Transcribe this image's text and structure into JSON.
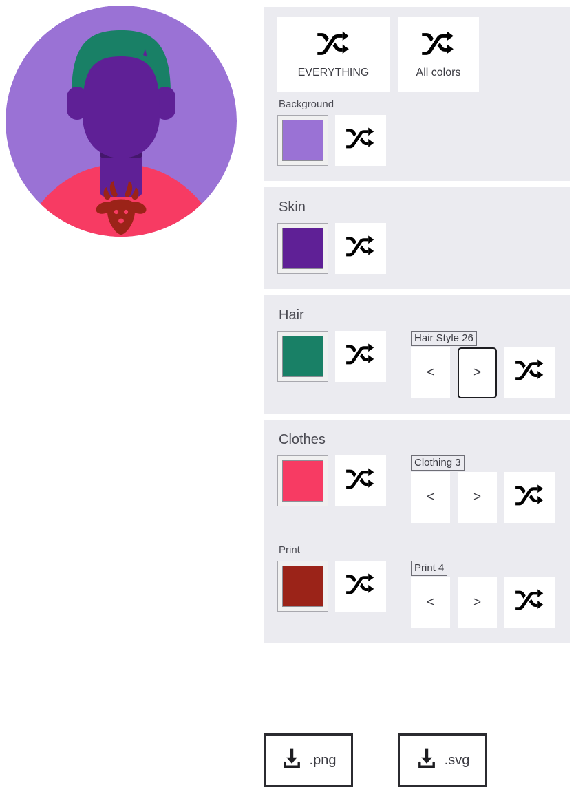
{
  "app": {
    "kind": "avatar-generator"
  },
  "avatar": {
    "background_color": "#9a72d5",
    "skin_color": "#5f2096",
    "hair_color": "#198066",
    "clothes_color": "#f73b63",
    "print_color": "#9b2318",
    "print_motif": "deer-head"
  },
  "randomize": {
    "everything": {
      "label": "EVERYTHING",
      "icon": "shuffle-icon"
    },
    "all_colors": {
      "label": "All colors",
      "icon": "shuffle-icon"
    }
  },
  "sections": [
    {
      "id": "background",
      "title": "Background",
      "title_size": "sub",
      "swatch": "#9a72d5",
      "shuffle_icon": "shuffle-icon",
      "stepper": null
    },
    {
      "id": "skin",
      "title": "Skin",
      "title_size": "main",
      "swatch": "#5f2096",
      "shuffle_icon": "shuffle-icon",
      "stepper": null
    },
    {
      "id": "hair",
      "title": "Hair",
      "title_size": "main",
      "swatch": "#198066",
      "shuffle_icon": "shuffle-icon",
      "stepper": {
        "label": "Hair Style 26",
        "prev": "<",
        "next": ">",
        "shuffle_icon": "shuffle-icon",
        "focused_button": "next"
      }
    },
    {
      "id": "clothes",
      "title": "Clothes",
      "title_size": "main",
      "swatch": "#f73b63",
      "shuffle_icon": "shuffle-icon",
      "stepper": {
        "label": "Clothing 3",
        "prev": "<",
        "next": ">",
        "shuffle_icon": "shuffle-icon",
        "focused_button": null
      }
    },
    {
      "id": "print",
      "title": "Print",
      "title_size": "sub",
      "swatch": "#9b2318",
      "shuffle_icon": "shuffle-icon",
      "stepper": {
        "label": "Print 4",
        "prev": "<",
        "next": ">",
        "shuffle_icon": "shuffle-icon",
        "focused_button": null
      }
    }
  ],
  "downloads": [
    {
      "id": "png",
      "label": ".png",
      "icon": "download-icon"
    },
    {
      "id": "svg",
      "label": ".svg",
      "icon": "download-icon"
    }
  ],
  "colors": {
    "panel_bg": "#ebebf0",
    "page_bg": "#ffffff",
    "button_bg": "#ffffff",
    "text": "#3b3b42",
    "title_text": "#4a4a52",
    "focus_border": "#1d1d21"
  }
}
